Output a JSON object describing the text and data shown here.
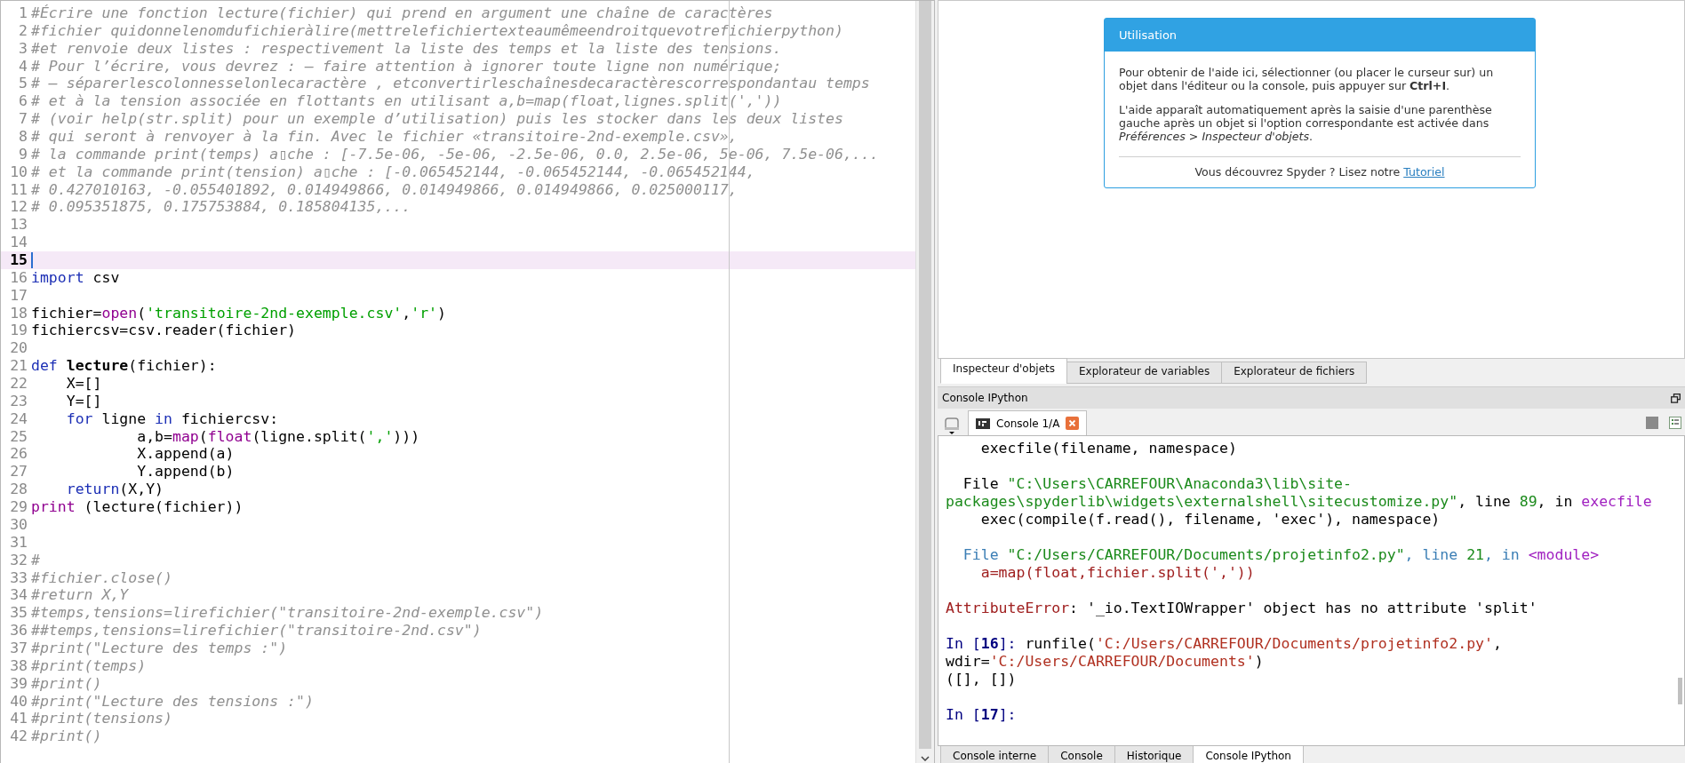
{
  "editor": {
    "lines": [
      {
        "n": "1",
        "current": false,
        "tokens": [
          {
            "t": "#Écrire une fonction lecture(fichier) qui prend en argument une chaîne de caractères",
            "kind": "comment"
          }
        ]
      },
      {
        "n": "2",
        "current": false,
        "tokens": [
          {
            "t": "#fichier quidonnelenomdufichieràlire(mettrelefichiertexteaumêmeendroitquevotrefichierpython)",
            "kind": "comment"
          }
        ]
      },
      {
        "n": "3",
        "current": false,
        "tokens": [
          {
            "t": "#et renvoie deux listes : respectivement la liste des temps et la liste des tensions.",
            "kind": "comment"
          }
        ]
      },
      {
        "n": "4",
        "current": false,
        "tokens": [
          {
            "t": "# Pour l’écrire, vous devrez : – faire attention à ignorer toute ligne non numérique;",
            "kind": "comment"
          }
        ]
      },
      {
        "n": "5",
        "current": false,
        "tokens": [
          {
            "t": "# – séparerlescolonnesselonlecaractère , etconvertirleschaînesdecaractèrescorrespondantau temps",
            "kind": "comment"
          }
        ]
      },
      {
        "n": "6",
        "current": false,
        "tokens": [
          {
            "t": "# et à la tension associée en flottants en utilisant a,b=map(float,lignes.split(','))",
            "kind": "comment"
          }
        ]
      },
      {
        "n": "7",
        "current": false,
        "tokens": [
          {
            "t": "# (voir help(str.split) pour un exemple d’utilisation) puis les stocker dans les deux listes",
            "kind": "comment"
          }
        ]
      },
      {
        "n": "8",
        "current": false,
        "tokens": [
          {
            "t": "# qui seront à renvoyer à la fin. Avec le fichier «transitoire-2nd-exemple.csv»,",
            "kind": "comment"
          }
        ]
      },
      {
        "n": "9",
        "current": false,
        "tokens": [
          {
            "t": "# la commande print(temps) a▯che : [-7.5e-06, -5e-06, -2.5e-06, 0.0, 2.5e-06, 5e-06, 7.5e-06,...",
            "kind": "comment"
          }
        ]
      },
      {
        "n": "10",
        "current": false,
        "tokens": [
          {
            "t": "# et la commande print(tension) a▯che : [-0.065452144, -0.065452144, -0.065452144,",
            "kind": "comment"
          }
        ]
      },
      {
        "n": "11",
        "current": false,
        "tokens": [
          {
            "t": "# 0.427010163, -0.055401892, 0.014949866, 0.014949866, 0.014949866, 0.025000117,",
            "kind": "comment"
          }
        ]
      },
      {
        "n": "12",
        "current": false,
        "tokens": [
          {
            "t": "# 0.095351875, 0.175753884, 0.185804135,...",
            "kind": "comment"
          }
        ]
      },
      {
        "n": "13",
        "current": false
      },
      {
        "n": "14",
        "current": false
      },
      {
        "n": "15",
        "current": true
      },
      {
        "n": "16",
        "current": false,
        "tokens": [
          {
            "t": "import",
            "kind": "keyword"
          },
          {
            "t": " csv",
            "kind": "plain"
          }
        ]
      },
      {
        "n": "17",
        "current": false
      },
      {
        "n": "18",
        "current": false,
        "tokens": [
          {
            "t": "fichier=",
            "kind": "plain"
          },
          {
            "t": "open",
            "kind": "builtin"
          },
          {
            "t": "(",
            "kind": "plain"
          },
          {
            "t": "'transitoire-2nd-exemple.csv'",
            "kind": "string"
          },
          {
            "t": ",",
            "kind": "plain"
          },
          {
            "t": "'r'",
            "kind": "string"
          },
          {
            "t": ")",
            "kind": "plain"
          }
        ]
      },
      {
        "n": "19",
        "current": false,
        "tokens": [
          {
            "t": "fichiercsv=csv.reader(fichier)",
            "kind": "plain"
          }
        ]
      },
      {
        "n": "20",
        "current": false
      },
      {
        "n": "21",
        "current": false,
        "tokens": [
          {
            "t": "def",
            "kind": "keyword"
          },
          {
            "t": " lecture",
            "kind": "defname"
          },
          {
            "t": "(fichier):",
            "kind": "plain"
          }
        ]
      },
      {
        "n": "22",
        "current": false,
        "tokens": [
          {
            "t": "    X=[]",
            "kind": "plain"
          }
        ]
      },
      {
        "n": "23",
        "current": false,
        "tokens": [
          {
            "t": "    Y=[]",
            "kind": "plain"
          }
        ]
      },
      {
        "n": "24",
        "current": false,
        "tokens": [
          {
            "t": "    for",
            "kind": "keyword"
          },
          {
            "t": " ligne ",
            "kind": "plain"
          },
          {
            "t": "in",
            "kind": "keyword"
          },
          {
            "t": " fichiercsv:",
            "kind": "plain"
          }
        ]
      },
      {
        "n": "25",
        "current": false,
        "tokens": [
          {
            "t": "            a,b=",
            "kind": "plain"
          },
          {
            "t": "map",
            "kind": "builtin"
          },
          {
            "t": "(",
            "kind": "plain"
          },
          {
            "t": "float",
            "kind": "builtin"
          },
          {
            "t": "(ligne.split(",
            "kind": "plain"
          },
          {
            "t": "','",
            "kind": "string"
          },
          {
            "t": ")))",
            "kind": "plain"
          }
        ]
      },
      {
        "n": "26",
        "current": false,
        "tokens": [
          {
            "t": "            X.append(a)",
            "kind": "plain"
          }
        ]
      },
      {
        "n": "27",
        "current": false,
        "tokens": [
          {
            "t": "            Y.append(b)",
            "kind": "plain"
          }
        ]
      },
      {
        "n": "28",
        "current": false,
        "tokens": [
          {
            "t": "    return",
            "kind": "keyword"
          },
          {
            "t": "(X,Y)",
            "kind": "plain"
          }
        ]
      },
      {
        "n": "29",
        "current": false,
        "tokens": [
          {
            "t": "print",
            "kind": "builtin"
          },
          {
            "t": " (lecture(fichier))",
            "kind": "plain"
          }
        ]
      },
      {
        "n": "30",
        "current": false
      },
      {
        "n": "31",
        "current": false
      },
      {
        "n": "32",
        "current": false,
        "tokens": [
          {
            "t": "#",
            "kind": "comment"
          }
        ]
      },
      {
        "n": "33",
        "current": false,
        "tokens": [
          {
            "t": "#fichier.close()",
            "kind": "comment"
          }
        ]
      },
      {
        "n": "34",
        "current": false,
        "tokens": [
          {
            "t": "#return X,Y",
            "kind": "comment"
          }
        ]
      },
      {
        "n": "35",
        "current": false,
        "tokens": [
          {
            "t": "#temps,tensions=lirefichier(\"transitoire-2nd-exemple.csv\")",
            "kind": "comment"
          }
        ]
      },
      {
        "n": "36",
        "current": false,
        "tokens": [
          {
            "t": "##temps,tensions=lirefichier(\"transitoire-2nd.csv\")",
            "kind": "comment"
          }
        ]
      },
      {
        "n": "37",
        "current": false,
        "tokens": [
          {
            "t": "#print(\"Lecture des temps :\")",
            "kind": "comment"
          }
        ]
      },
      {
        "n": "38",
        "current": false,
        "tokens": [
          {
            "t": "#print(temps)",
            "kind": "comment"
          }
        ]
      },
      {
        "n": "39",
        "current": false,
        "tokens": [
          {
            "t": "#print()",
            "kind": "comment"
          }
        ]
      },
      {
        "n": "40",
        "current": false,
        "tokens": [
          {
            "t": "#print(\"Lecture des tensions :\")",
            "kind": "comment"
          }
        ]
      },
      {
        "n": "41",
        "current": false,
        "tokens": [
          {
            "t": "#print(tensions)",
            "kind": "comment"
          }
        ]
      },
      {
        "n": "42",
        "current": false,
        "tokens": [
          {
            "t": "#print()",
            "kind": "comment"
          }
        ]
      }
    ]
  },
  "help": {
    "title": "Utilisation",
    "paragraphs": [
      "Pour obtenir de l'aide ici, sélectionner (ou placer le curseur sur) un objet dans l'éditeur ou la console, puis appuyer sur **Ctrl+I**.",
      "L'aide apparaît automatiquement après la saisie d'une parenthèse gauche après un objet si l'option correspondante est activée dans *Préférences > Inspecteur d'objets*."
    ],
    "footer": "Vous découvrez Spyder ? Lisez notre ",
    "link": "Tutoriel"
  },
  "top_tabs": [
    {
      "label": "Inspecteur d'objets",
      "selected": true
    },
    {
      "label": "Explorateur de variables",
      "selected": false
    },
    {
      "label": "Explorateur de fichiers",
      "selected": false
    }
  ],
  "console_pane": {
    "title": "Console IPython",
    "tabs": [
      {
        "label": "Console 1/A",
        "selected": true
      }
    ],
    "blocks": [
      {
        "lines": [
          [
            {
              "t": "    execfile(filename, namespace)",
              "kind": "plain"
            }
          ]
        ]
      },
      {
        "lines": [
          [
            {
              "t": "  File ",
              "kind": "plain"
            },
            {
              "t": "\"C:\\Users\\CARREFOUR\\Anaconda3\\lib\\site-",
              "kind": "string"
            }
          ],
          [
            {
              "t": "packages\\spyderlib\\widgets\\externalshell\\sitecustomize.py\"",
              "kind": "string"
            },
            {
              "t": ", line ",
              "kind": "plain"
            },
            {
              "t": "89",
              "kind": "string"
            },
            {
              "t": ", in ",
              "kind": "plain"
            },
            {
              "t": "execfile",
              "kind": "name"
            }
          ],
          [
            {
              "t": "    exec(compile(f.read(), filename, 'exec'), namespace)",
              "kind": "plain"
            }
          ]
        ]
      },
      {
        "lines": [
          [
            {
              "t": "  File ",
              "kind": "info"
            },
            {
              "t": "\"C:/Users/CARREFOUR/Documents/projetinfo2.py\"",
              "kind": "string"
            },
            {
              "t": ", line ",
              "kind": "info"
            },
            {
              "t": "21",
              "kind": "string"
            },
            {
              "t": ", in ",
              "kind": "info"
            },
            {
              "t": "<module>",
              "kind": "name"
            }
          ],
          [
            {
              "t": "    a=map(float,fichier.split(','))",
              "kind": "error"
            }
          ]
        ]
      },
      {
        "lines": [
          [
            {
              "t": "AttributeError",
              "kind": "error"
            },
            {
              "t": ": '_io.TextIOWrapper' object has no attribute 'split'",
              "kind": "plain"
            }
          ]
        ]
      },
      {
        "lines": [
          [
            {
              "t": "In [",
              "kind": "prompt"
            },
            {
              "t": "16",
              "kind": "promptnum"
            },
            {
              "t": "]: ",
              "kind": "prompt"
            },
            {
              "t": "runfile(",
              "kind": "plain"
            },
            {
              "t": "'C:/Users/CARREFOUR/Documents/projetinfo2.py'",
              "kind": "path"
            },
            {
              "t": ",",
              "kind": "plain"
            }
          ],
          [
            {
              "t": "wdir=",
              "kind": "plain"
            },
            {
              "t": "'C:/Users/CARREFOUR/Documents'",
              "kind": "path"
            },
            {
              "t": ")",
              "kind": "plain"
            }
          ],
          [
            {
              "t": "([], [])",
              "kind": "plain"
            }
          ]
        ]
      },
      {
        "lines": [
          [
            {
              "t": "In [",
              "kind": "prompt"
            },
            {
              "t": "17",
              "kind": "promptnum"
            },
            {
              "t": "]:",
              "kind": "prompt"
            }
          ]
        ]
      }
    ]
  },
  "bottom_tabs": [
    {
      "label": "Console interne",
      "selected": false
    },
    {
      "label": "Console",
      "selected": false
    },
    {
      "label": "Historique",
      "selected": false
    },
    {
      "label": "Console IPython",
      "selected": true
    }
  ]
}
